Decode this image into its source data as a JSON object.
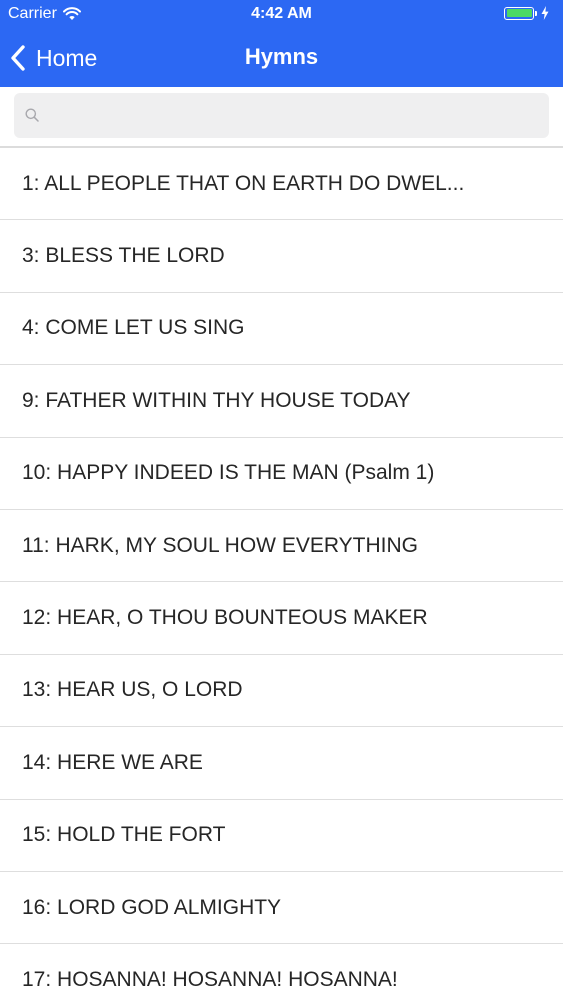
{
  "status_bar": {
    "carrier": "Carrier",
    "time": "4:42 AM",
    "battery_color": "#4cd964"
  },
  "nav": {
    "back_label": "Home",
    "title": "Hymns",
    "bar_color": "#2c68f3"
  },
  "search": {
    "placeholder": "",
    "value": ""
  },
  "hymns": [
    {
      "label": "1: ALL PEOPLE THAT ON EARTH DO DWEL..."
    },
    {
      "label": "3: BLESS THE LORD"
    },
    {
      "label": "4: COME LET US SING"
    },
    {
      "label": "9: FATHER WITHIN THY HOUSE TODAY"
    },
    {
      "label": "10: HAPPY INDEED IS THE MAN (Psalm 1)"
    },
    {
      "label": "11: HARK, MY SOUL HOW EVERYTHING"
    },
    {
      "label": "12: HEAR, O THOU BOUNTEOUS MAKER"
    },
    {
      "label": "13: HEAR US, O LORD"
    },
    {
      "label": "14: HERE WE ARE"
    },
    {
      "label": "15: HOLD THE FORT"
    },
    {
      "label": "16: LORD GOD ALMIGHTY"
    },
    {
      "label": "17: HOSANNA! HOSANNA! HOSANNA!"
    }
  ]
}
